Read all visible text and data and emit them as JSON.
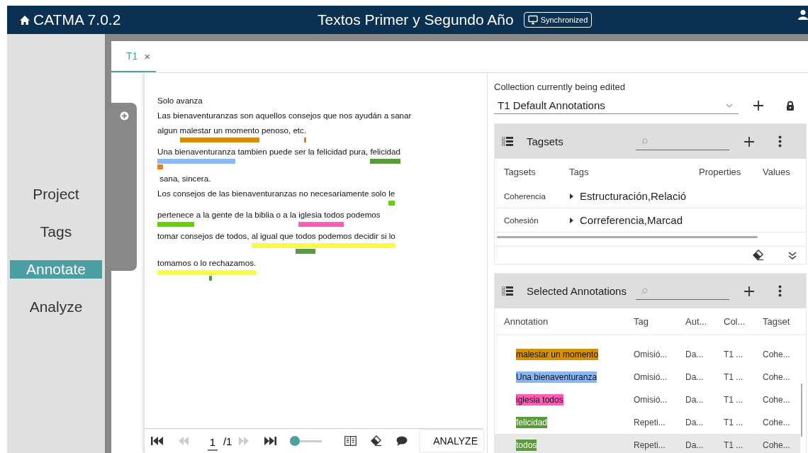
{
  "header": {
    "app_title": "CATMA 7.0.2",
    "project_title": "Textos Primer y Segundo Año",
    "sync_badge": "Synchronized"
  },
  "nav": [
    {
      "label": "Project",
      "selected": false
    },
    {
      "label": "Tags",
      "selected": false
    },
    {
      "label": "Annotate",
      "selected": true
    },
    {
      "label": "Analyze",
      "selected": false
    }
  ],
  "tabs": [
    {
      "label": "T1",
      "close": "×",
      "selected": true
    }
  ],
  "document": {
    "lines": [
      {
        "segments": [
          {
            "text": "Solo avanza"
          }
        ]
      },
      {
        "segments": [
          {
            "text": "Las bienaventuranzas son aquellos consejos que nos ayudán a sanar"
          }
        ]
      },
      {
        "segments": [
          {
            "text": "algun "
          },
          {
            "text": "malestar un momento",
            "bars": [
              {
                "color": "#d4900a"
              }
            ]
          },
          {
            "text": " penoso, etc"
          },
          {
            "text": ".",
            "bars": [
              {
                "color": "#e67e22"
              }
            ]
          }
        ]
      },
      {
        "segments": [
          {
            "text": "U",
            "bars": [
              {
                "color": "#8ab8f5"
              },
              {
                "color": "#e67e22"
              }
            ]
          },
          {
            "text": "na bienaventuranza",
            "bars": [
              {
                "color": "#8ab8f5"
              }
            ]
          },
          {
            "text": " tambien puede ser la felicidad pura, "
          },
          {
            "text": "felicidad",
            "bars": [
              {
                "color": "#5b9a3c"
              }
            ]
          }
        ]
      },
      {
        "segments": [
          {
            "text": " sana, sincera."
          }
        ]
      },
      {
        "segments": [
          {
            "text": "Los consejos de las bienaventuranzas no necesariamente solo "
          },
          {
            "text": "le",
            "bars": [
              {
                "color": "#66d100"
              }
            ]
          }
        ]
      },
      {
        "segments": [
          {
            "text": "pertenece",
            "bars": [
              {
                "color": "#66d100"
              }
            ]
          },
          {
            "text": " a la gente de la biblia o a la "
          },
          {
            "text": "iglesia todos",
            "bars": [
              {
                "color": "#ff5cb8"
              }
            ]
          },
          {
            "text": " podemos"
          }
        ]
      },
      {
        "segments": [
          {
            "text": "tomar consejos de todos, "
          },
          {
            "text": "al igual que ",
            "bars": [
              {
                "color": "#f8fc45"
              }
            ]
          },
          {
            "text": "todos",
            "bars": [
              {
                "color": "#f8fc45"
              },
              {
                "color": "#5b9a3c"
              }
            ]
          },
          {
            "text": " podemos decidir si lo",
            "bars": [
              {
                "color": "#f8fc45"
              }
            ]
          }
        ]
      },
      {
        "segments": [
          {
            "text": "tomamos o lo ",
            "bars": [
              {
                "color": "#f8fc45"
              }
            ]
          },
          {
            "text": "r",
            "bars": [
              {
                "color": "#f8fc45"
              },
              {
                "color": "#5b9a3c"
              }
            ]
          },
          {
            "text": "echazamos.",
            "bars": [
              {
                "color": "#f8fc45"
              }
            ]
          }
        ]
      }
    ]
  },
  "toolbar": {
    "buttons": [
      {
        "kind": "first",
        "disabled": false
      },
      {
        "kind": "prev",
        "disabled": true
      }
    ],
    "page": "1",
    "page_total": "/1",
    "buttons_after": [
      {
        "kind": "next",
        "disabled": true
      },
      {
        "kind": "last",
        "disabled": false
      }
    ],
    "slider": {
      "level": 0
    },
    "analyze_button": "ANALYZE"
  },
  "collection": {
    "label": "Collection currently being edited",
    "value": "T1 Default Annotations"
  },
  "tagsets": {
    "title": "Tagsets",
    "columns": [
      "Tagsets",
      "Tags",
      "Properties",
      "Values"
    ],
    "rows": [
      {
        "tagset": "Coherencia",
        "tags": "Estructuración,Relació",
        "expanded": false
      },
      {
        "tagset": "Cohesión",
        "tags": "Correferencia,Marcad",
        "expanded": false
      }
    ]
  },
  "selected_annotations": {
    "title": "Selected Annotations",
    "columns": [
      "Annotation",
      "Tag",
      "Aut...",
      "Col...",
      "Tagset"
    ],
    "rows": [
      {
        "annotation": "malestar un momento",
        "color": "#d4900a",
        "tag": "Omisió...",
        "author": "Da...",
        "collection": "T1 ...",
        "tagset": "Cohe...",
        "selected": false
      },
      {
        "annotation": "Una bienaventuranza",
        "color": "#8ab8f5",
        "tag": "Omisió...",
        "author": "Da...",
        "collection": "T1 ...",
        "tagset": "Cohe...",
        "selected": false
      },
      {
        "annotation": "iglesia todos",
        "color": "#ff5cb8",
        "tag": "Omisió...",
        "author": "Da...",
        "collection": "T1 ...",
        "tagset": "Cohe...",
        "selected": false
      },
      {
        "annotation": "felicidad",
        "color": "#5b9a3c",
        "tag": "Repeti...",
        "author": "Da...",
        "collection": "T1 ...",
        "tagset": "Cohe...",
        "selected": false
      },
      {
        "annotation": "todos",
        "color": "#5b9a3c",
        "tag": "Repeti...",
        "author": "Da...",
        "collection": "T1 ...",
        "tagset": "Cohe...",
        "selected": true
      }
    ]
  }
}
